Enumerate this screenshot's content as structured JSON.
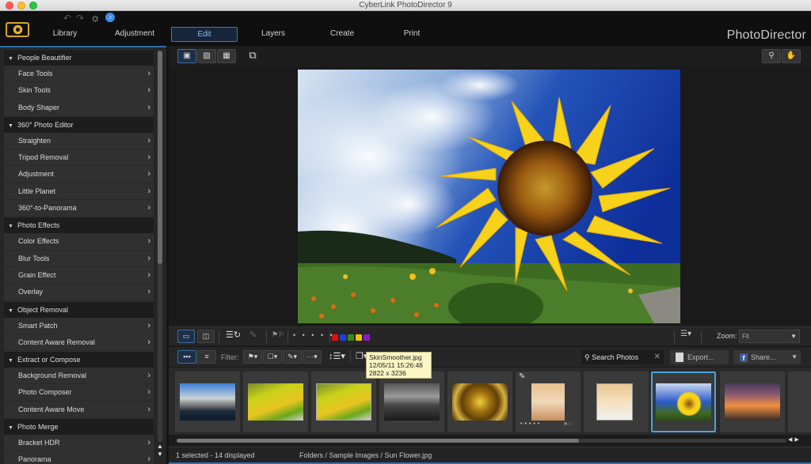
{
  "window": {
    "title": "CyberLink PhotoDirector 9"
  },
  "header": {
    "brand": "PhotoDirector",
    "tabs": [
      {
        "label": "Library",
        "active": false
      },
      {
        "label": "Adjustment",
        "active": false
      },
      {
        "label": "Edit",
        "active": true
      },
      {
        "label": "Layers",
        "active": false
      },
      {
        "label": "Create",
        "active": false
      },
      {
        "label": "Print",
        "active": false
      }
    ],
    "icons": [
      "undo-icon",
      "redo-icon",
      "settings-gear-icon",
      "notification-icon"
    ]
  },
  "sidebar": {
    "categories": [
      {
        "label": "People Beautifier",
        "items": [
          "Face Tools",
          "Skin Tools",
          "Body Shaper"
        ]
      },
      {
        "label": "360° Photo Editor",
        "items": [
          "Straighten",
          "Tripod Removal",
          "Adjustment",
          "Little Planet",
          "360°-to-Panorama"
        ]
      },
      {
        "label": "Photo Effects",
        "items": [
          "Color Effects",
          "Blur Tools",
          "Grain Effect",
          "Overlay"
        ]
      },
      {
        "label": "Object Removal",
        "items": [
          "Smart Patch",
          "Content Aware Removal"
        ]
      },
      {
        "label": "Extract or Compose",
        "items": [
          "Background Removal",
          "Photo Composer",
          "Content Aware Move"
        ]
      },
      {
        "label": "Photo Merge",
        "items": [
          "Bracket HDR",
          "Panorama"
        ]
      }
    ],
    "scroll_position": 0
  },
  "viewbar": {
    "view_modes": [
      "viewer-filmstrip-icon",
      "viewer-icon",
      "grid-icon"
    ],
    "active_view": 0,
    "tools": [
      "compare-icon",
      "zoom-tool-icon",
      "pan-hand-icon"
    ]
  },
  "toolbar": {
    "layout_buttons": [
      "single-view-icon",
      "side-by-side-icon"
    ],
    "rotate_icon": "rotate-icon",
    "edit_icon": "edit-pencil-icon",
    "flag_icon": "flag-icon",
    "rating_dots": "• • • • •",
    "color_labels": [
      "#e01010",
      "#1d3fe0",
      "#3a8a1a",
      "#f0c000",
      "#8a1ad0"
    ],
    "sort_icon": "sort-icon",
    "zoom_label": "Zoom:",
    "zoom_value": "Fit"
  },
  "filterbar": {
    "filter_label": "Filter:",
    "filter_dropdowns": [
      "flag-filter-icon",
      "frame-filter-icon",
      "edit-filter-icon",
      "rating-filter-icon"
    ],
    "rating_dots": "• • • •",
    "sort_icon": "line-spacing-icon",
    "stack_icon": "stack-icon",
    "search_placeholder": "Search Photos",
    "export_label": "Export...",
    "share_label": "Share..."
  },
  "filmstrip": {
    "thumbs": [
      {
        "name": "lake-mountains"
      },
      {
        "name": "bicycle-field"
      },
      {
        "name": "bicycle-field-edited"
      },
      {
        "name": "church-bw"
      },
      {
        "name": "spiral-staircase"
      },
      {
        "name": "skin-smoother"
      },
      {
        "name": "portrait-edited"
      },
      {
        "name": "sun-flower",
        "selected": true
      },
      {
        "name": "sunset"
      }
    ],
    "tooltip": {
      "filename": "SkinSmoother.jpg",
      "date": "12/05/11 15:26:48",
      "dimensions": "2822 x 3236"
    },
    "scroll_fraction": 0.66
  },
  "status": {
    "count": "1 selected - 14 displayed",
    "path": "Folders / Sample Images / Sun Flower.jpg"
  }
}
